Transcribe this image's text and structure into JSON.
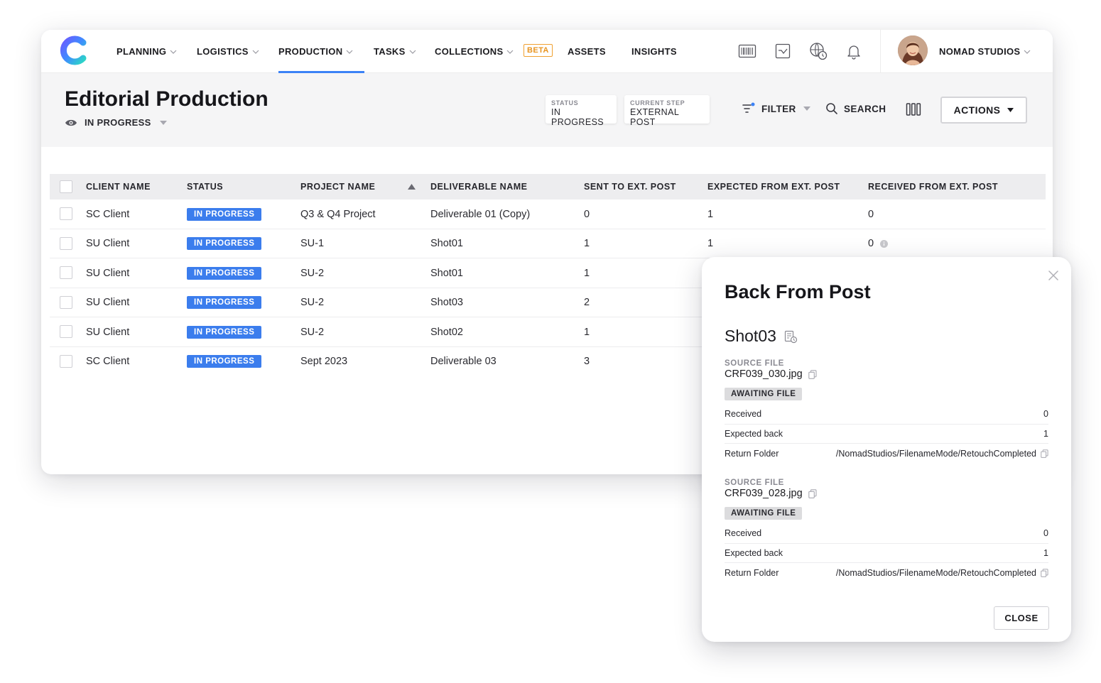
{
  "nav": {
    "items": [
      {
        "label": "PLANNING",
        "has_menu": true
      },
      {
        "label": "LOGISTICS",
        "has_menu": true
      },
      {
        "label": "PRODUCTION",
        "has_menu": true,
        "active": true
      },
      {
        "label": "TASKS",
        "has_menu": true
      },
      {
        "label": "COLLECTIONS",
        "has_menu": true
      },
      {
        "label": "ASSETS",
        "has_menu": false
      },
      {
        "label": "INSIGHTS",
        "has_menu": false
      }
    ],
    "beta_badge": "BETA",
    "org_name": "NOMAD STUDIOS",
    "accent_color": "#3b82f6",
    "icons": [
      "barcode-icon",
      "reports-icon",
      "globe-clock-icon",
      "bell-icon"
    ]
  },
  "page": {
    "title": "Editorial Production",
    "view_status": "IN PROGRESS",
    "chips": [
      {
        "label": "STATUS",
        "value": "IN PROGRESS"
      },
      {
        "label": "CURRENT STEP",
        "value": "EXTERNAL POST"
      }
    ],
    "filter_label": "FILTER",
    "search_label": "SEARCH",
    "actions_label": "ACTIONS"
  },
  "table": {
    "columns": [
      "CLIENT NAME",
      "STATUS",
      "PROJECT NAME",
      "DELIVERABLE NAME",
      "SENT TO EXT. POST",
      "EXPECTED FROM EXT. POST",
      "RECEIVED FROM EXT. POST"
    ],
    "sorted_column": "PROJECT NAME",
    "rows": [
      {
        "client": "SC Client",
        "status": "IN PROGRESS",
        "project": "Q3 & Q4 Project",
        "deliverable": "Deliverable 01 (Copy)",
        "sent": "0",
        "expected": "1",
        "received": "0"
      },
      {
        "client": "SU Client",
        "status": "IN PROGRESS",
        "project": "SU-1",
        "deliverable": "Shot01",
        "sent": "1",
        "expected": "1",
        "received": "0"
      },
      {
        "client": "SU Client",
        "status": "IN PROGRESS",
        "project": "SU-2",
        "deliverable": "Shot01",
        "sent": "1",
        "expected": "",
        "received": ""
      },
      {
        "client": "SU Client",
        "status": "IN PROGRESS",
        "project": "SU-2",
        "deliverable": "Shot03",
        "sent": "2",
        "expected": "",
        "received": ""
      },
      {
        "client": "SU Client",
        "status": "IN PROGRESS",
        "project": "SU-2",
        "deliverable": "Shot02",
        "sent": "1",
        "expected": "",
        "received": ""
      },
      {
        "client": "SC Client",
        "status": "IN PROGRESS",
        "project": "Sept 2023",
        "deliverable": "Deliverable 03",
        "sent": "3",
        "expected": "",
        "received": ""
      }
    ],
    "status_color": "#3b7ded"
  },
  "modal": {
    "title": "Back From Post",
    "subtitle": "Shot03",
    "sources": [
      {
        "label": "SOURCE FILE",
        "file": "CRF039_030.jpg",
        "state": "AWAITING FILE",
        "fields": [
          {
            "key": "Received",
            "value": "0"
          },
          {
            "key": "Expected back",
            "value": "1"
          },
          {
            "key": "Return Folder",
            "value": "/NomadStudios/FilenameMode/RetouchCompleted"
          }
        ]
      },
      {
        "label": "SOURCE FILE",
        "file": "CRF039_028.jpg",
        "state": "AWAITING FILE",
        "fields": [
          {
            "key": "Received",
            "value": "0"
          },
          {
            "key": "Expected back",
            "value": "1"
          },
          {
            "key": "Return Folder",
            "value": "/NomadStudios/FilenameMode/RetouchCompleted"
          }
        ]
      }
    ],
    "close_label": "CLOSE"
  }
}
